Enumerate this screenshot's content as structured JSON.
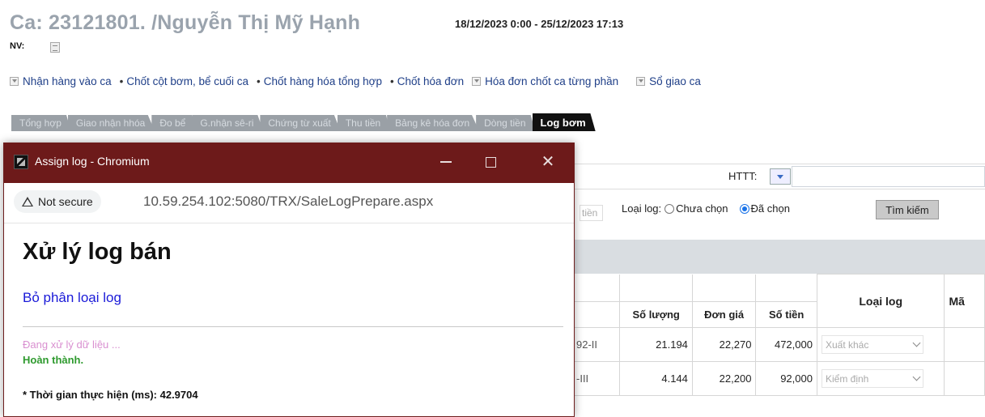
{
  "header": {
    "ca_title": "Ca: 23121801. /Nguyễn Thị Mỹ Hạnh",
    "date_range": "18/12/2023 0:00 - 25/12/2023 17:13",
    "nv_label": "NV:"
  },
  "menu": [
    {
      "label": "Nhận hàng vào ca",
      "marker": "box"
    },
    {
      "label": "Chốt cột bơm, bể cuối ca",
      "marker": "dot"
    },
    {
      "label": "Chốt hàng hóa tổng hợp",
      "marker": "dot"
    },
    {
      "label": "Chốt hóa đơn",
      "marker": "dot"
    },
    {
      "label": "Hóa đơn chốt ca từng phần",
      "marker": "box"
    },
    {
      "label": "Sổ giao ca",
      "marker": "box"
    }
  ],
  "tabs": [
    {
      "label": "Tổng hợp"
    },
    {
      "label": "Giao nhận hhóa"
    },
    {
      "label": "Đo bể"
    },
    {
      "label": "G.nhận sê-ri"
    },
    {
      "label": "Chứng từ xuất"
    },
    {
      "label": "Thu tiền"
    },
    {
      "label": "Bảng kê hóa đơn"
    },
    {
      "label": "Dòng tiền"
    },
    {
      "label": "Log bơm",
      "active": true
    }
  ],
  "filters": {
    "httt_label": "HTTT:",
    "tien_fragment": "tiền",
    "loai_log_label": "Loại log:",
    "radio_chua_chon": "Chưa chọn",
    "radio_da_chon": "Đã chọn",
    "selected_radio": "Đã chọn",
    "search_button": "Tìm kiếm"
  },
  "table": {
    "headers": {
      "so_luong": "Số lượng",
      "don_gia": "Đơn giá",
      "so_tien": "Số tiền",
      "loai_log": "Loại log",
      "ma": "Mã"
    },
    "rows": [
      {
        "code_fragment": "92-II",
        "so_luong": "21.194",
        "don_gia": "22,270",
        "so_tien": "472,000",
        "loai_log": "Xuất khác"
      },
      {
        "code_fragment": "-III",
        "so_luong": "4.144",
        "don_gia": "22,200",
        "so_tien": "92,000",
        "loai_log": "Kiểm định"
      }
    ]
  },
  "popup": {
    "window_title": "Assign log - Chromium",
    "security_chip": "Not secure",
    "url": "10.59.254.102:5080/TRX/SaleLogPrepare.aspx",
    "heading": "Xử lý log bán",
    "link": "Bỏ phân loại log",
    "processing": "Đang xử lý dữ liệu ...",
    "done": "Hoàn thành.",
    "time_label": "* Thời gian thực hiện (ms): 42.9704"
  },
  "colors": {
    "titlebar": "#6d1a1a",
    "active_tab": "#111111",
    "inactive_tab": "#9aa0a6",
    "link": "#1a1ad8",
    "processing": "#d98fd0",
    "done": "#2e9a2e"
  }
}
